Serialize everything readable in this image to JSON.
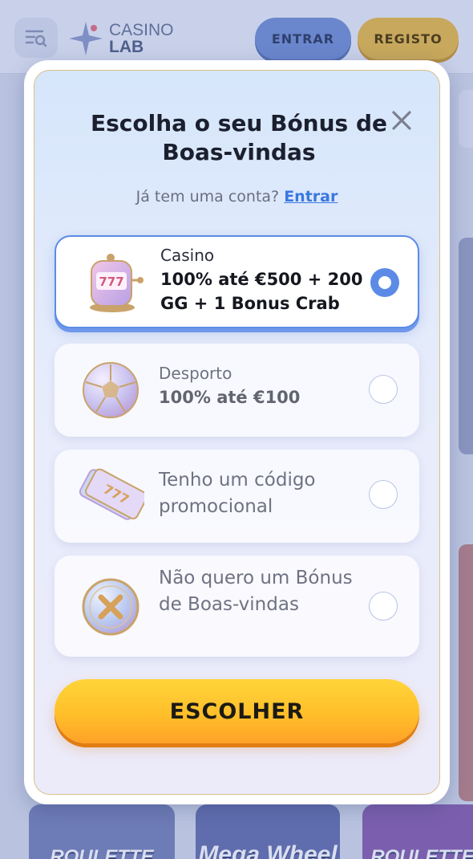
{
  "header": {
    "logo_line1": "CASINO",
    "logo_line2": "LAB",
    "login_button": "ENTRAR",
    "register_button": "REGISTO"
  },
  "background_games": [
    {
      "title": "ROULETTE"
    },
    {
      "title": "Mega Wheel"
    },
    {
      "title": "ROULETTE"
    }
  ],
  "modal": {
    "title": "Escolha o seu Bónus de Boas-vindas",
    "login_prompt": "Já tem uma conta?",
    "login_link": "Entrar",
    "options": [
      {
        "label": "Casino",
        "value": "100% até €500 + 200 GG + 1 Bonus Crab",
        "icon": "slot-machine-icon",
        "selected": true
      },
      {
        "label": "Desporto",
        "value": "100% até €100",
        "icon": "soccer-ball-icon",
        "selected": false
      },
      {
        "label": "Tenho um código promocional",
        "icon": "ticket-icon",
        "selected": false
      },
      {
        "label": "Não quero um Bónus de Boas-vindas",
        "icon": "x-coin-icon",
        "selected": false
      }
    ],
    "choose_button": "ESCOLHER"
  },
  "colors": {
    "accent_blue": "#5b8be6",
    "button_yellow": "#ffc12d",
    "link_blue": "#3a78e0"
  }
}
